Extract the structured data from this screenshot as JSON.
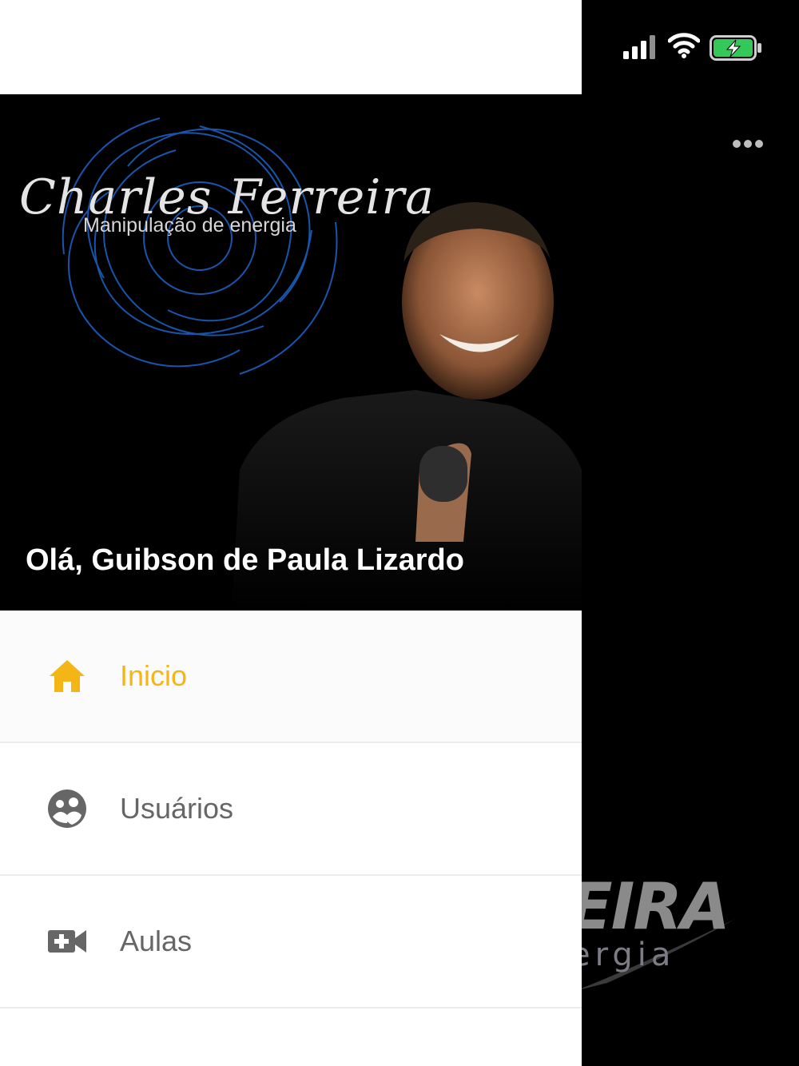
{
  "colors": {
    "accent": "#f4b516",
    "inactive_text": "#666666",
    "drawer_bg": "#ffffff",
    "background": "#000000",
    "battery_green": "#34c759"
  },
  "status_bar": {
    "icons": [
      "signal-icon",
      "wifi-icon",
      "charging-battery-icon"
    ]
  },
  "background_screen": {
    "more_icon": "more-horizontal-icon",
    "logo_text": "EIRA",
    "logo_subtext": "ergia"
  },
  "drawer": {
    "brand": {
      "name": "Charles Ferreira",
      "tagline": "Manipulação de energia"
    },
    "greeting": "Olá, Guibson de Paula Lizardo",
    "menu": [
      {
        "label": "Inicio",
        "icon": "home-icon",
        "active": true
      },
      {
        "label": "Usuários",
        "icon": "users-icon",
        "active": false
      },
      {
        "label": "Aulas",
        "icon": "video-add-icon",
        "active": false
      }
    ]
  }
}
